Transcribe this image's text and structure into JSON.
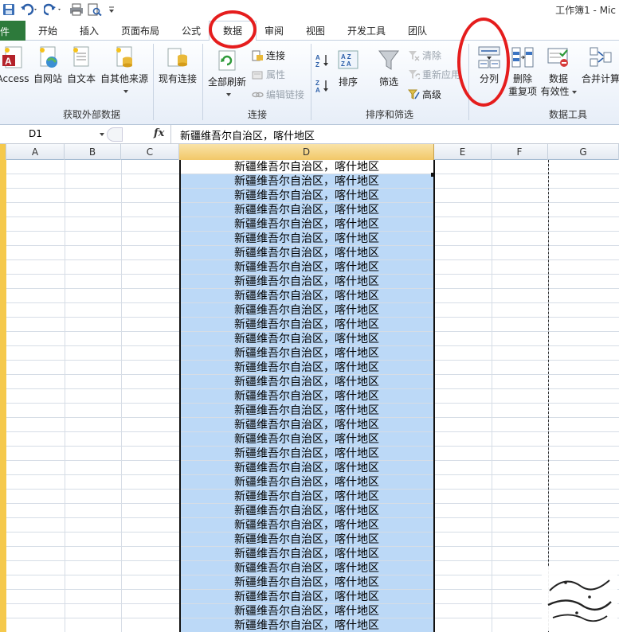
{
  "title_bar": {
    "window_title": "工作簿1 - Mic"
  },
  "tabs": {
    "file": "件",
    "items": [
      "开始",
      "插入",
      "页面布局",
      "公式",
      "数据",
      "审阅",
      "视图",
      "开发工具",
      "团队"
    ],
    "active": "数据"
  },
  "ribbon": {
    "get_external": {
      "group_label": "获取外部数据",
      "access": "Access",
      "web": "自网站",
      "text": "自文本",
      "other": "自其他来源"
    },
    "existing_conn": "现有连接",
    "connections": {
      "group_label": "连接",
      "refresh_all": "全部刷新",
      "connections": "连接",
      "properties": "属性",
      "edit_links": "编辑链接"
    },
    "sort_filter": {
      "group_label": "排序和筛选",
      "sort": "排序",
      "filter": "筛选",
      "clear": "清除",
      "reapply": "重新应用",
      "advanced": "高级"
    },
    "data_tools": {
      "group_label": "数据工具",
      "text_to_columns": "分列",
      "remove_dup_1": "删除",
      "remove_dup_2": "重复项",
      "validation_1": "数据",
      "validation_2": "有效性",
      "consolidate": "合并计算"
    }
  },
  "formula_bar": {
    "name_box": "D1",
    "fx": "fx",
    "content": "新疆维吾尔自治区，喀什地区"
  },
  "columns": [
    "A",
    "B",
    "C",
    "D",
    "E",
    "F",
    "G"
  ],
  "cell_value": "新疆维吾尔自治区，喀什地区",
  "row_count": 33,
  "colors": {
    "file_tab": "#2d7a3b",
    "selection": "#bcd9f7",
    "annotation_circle": "#e51d1d",
    "row_header_selected": "#f5c94c"
  }
}
